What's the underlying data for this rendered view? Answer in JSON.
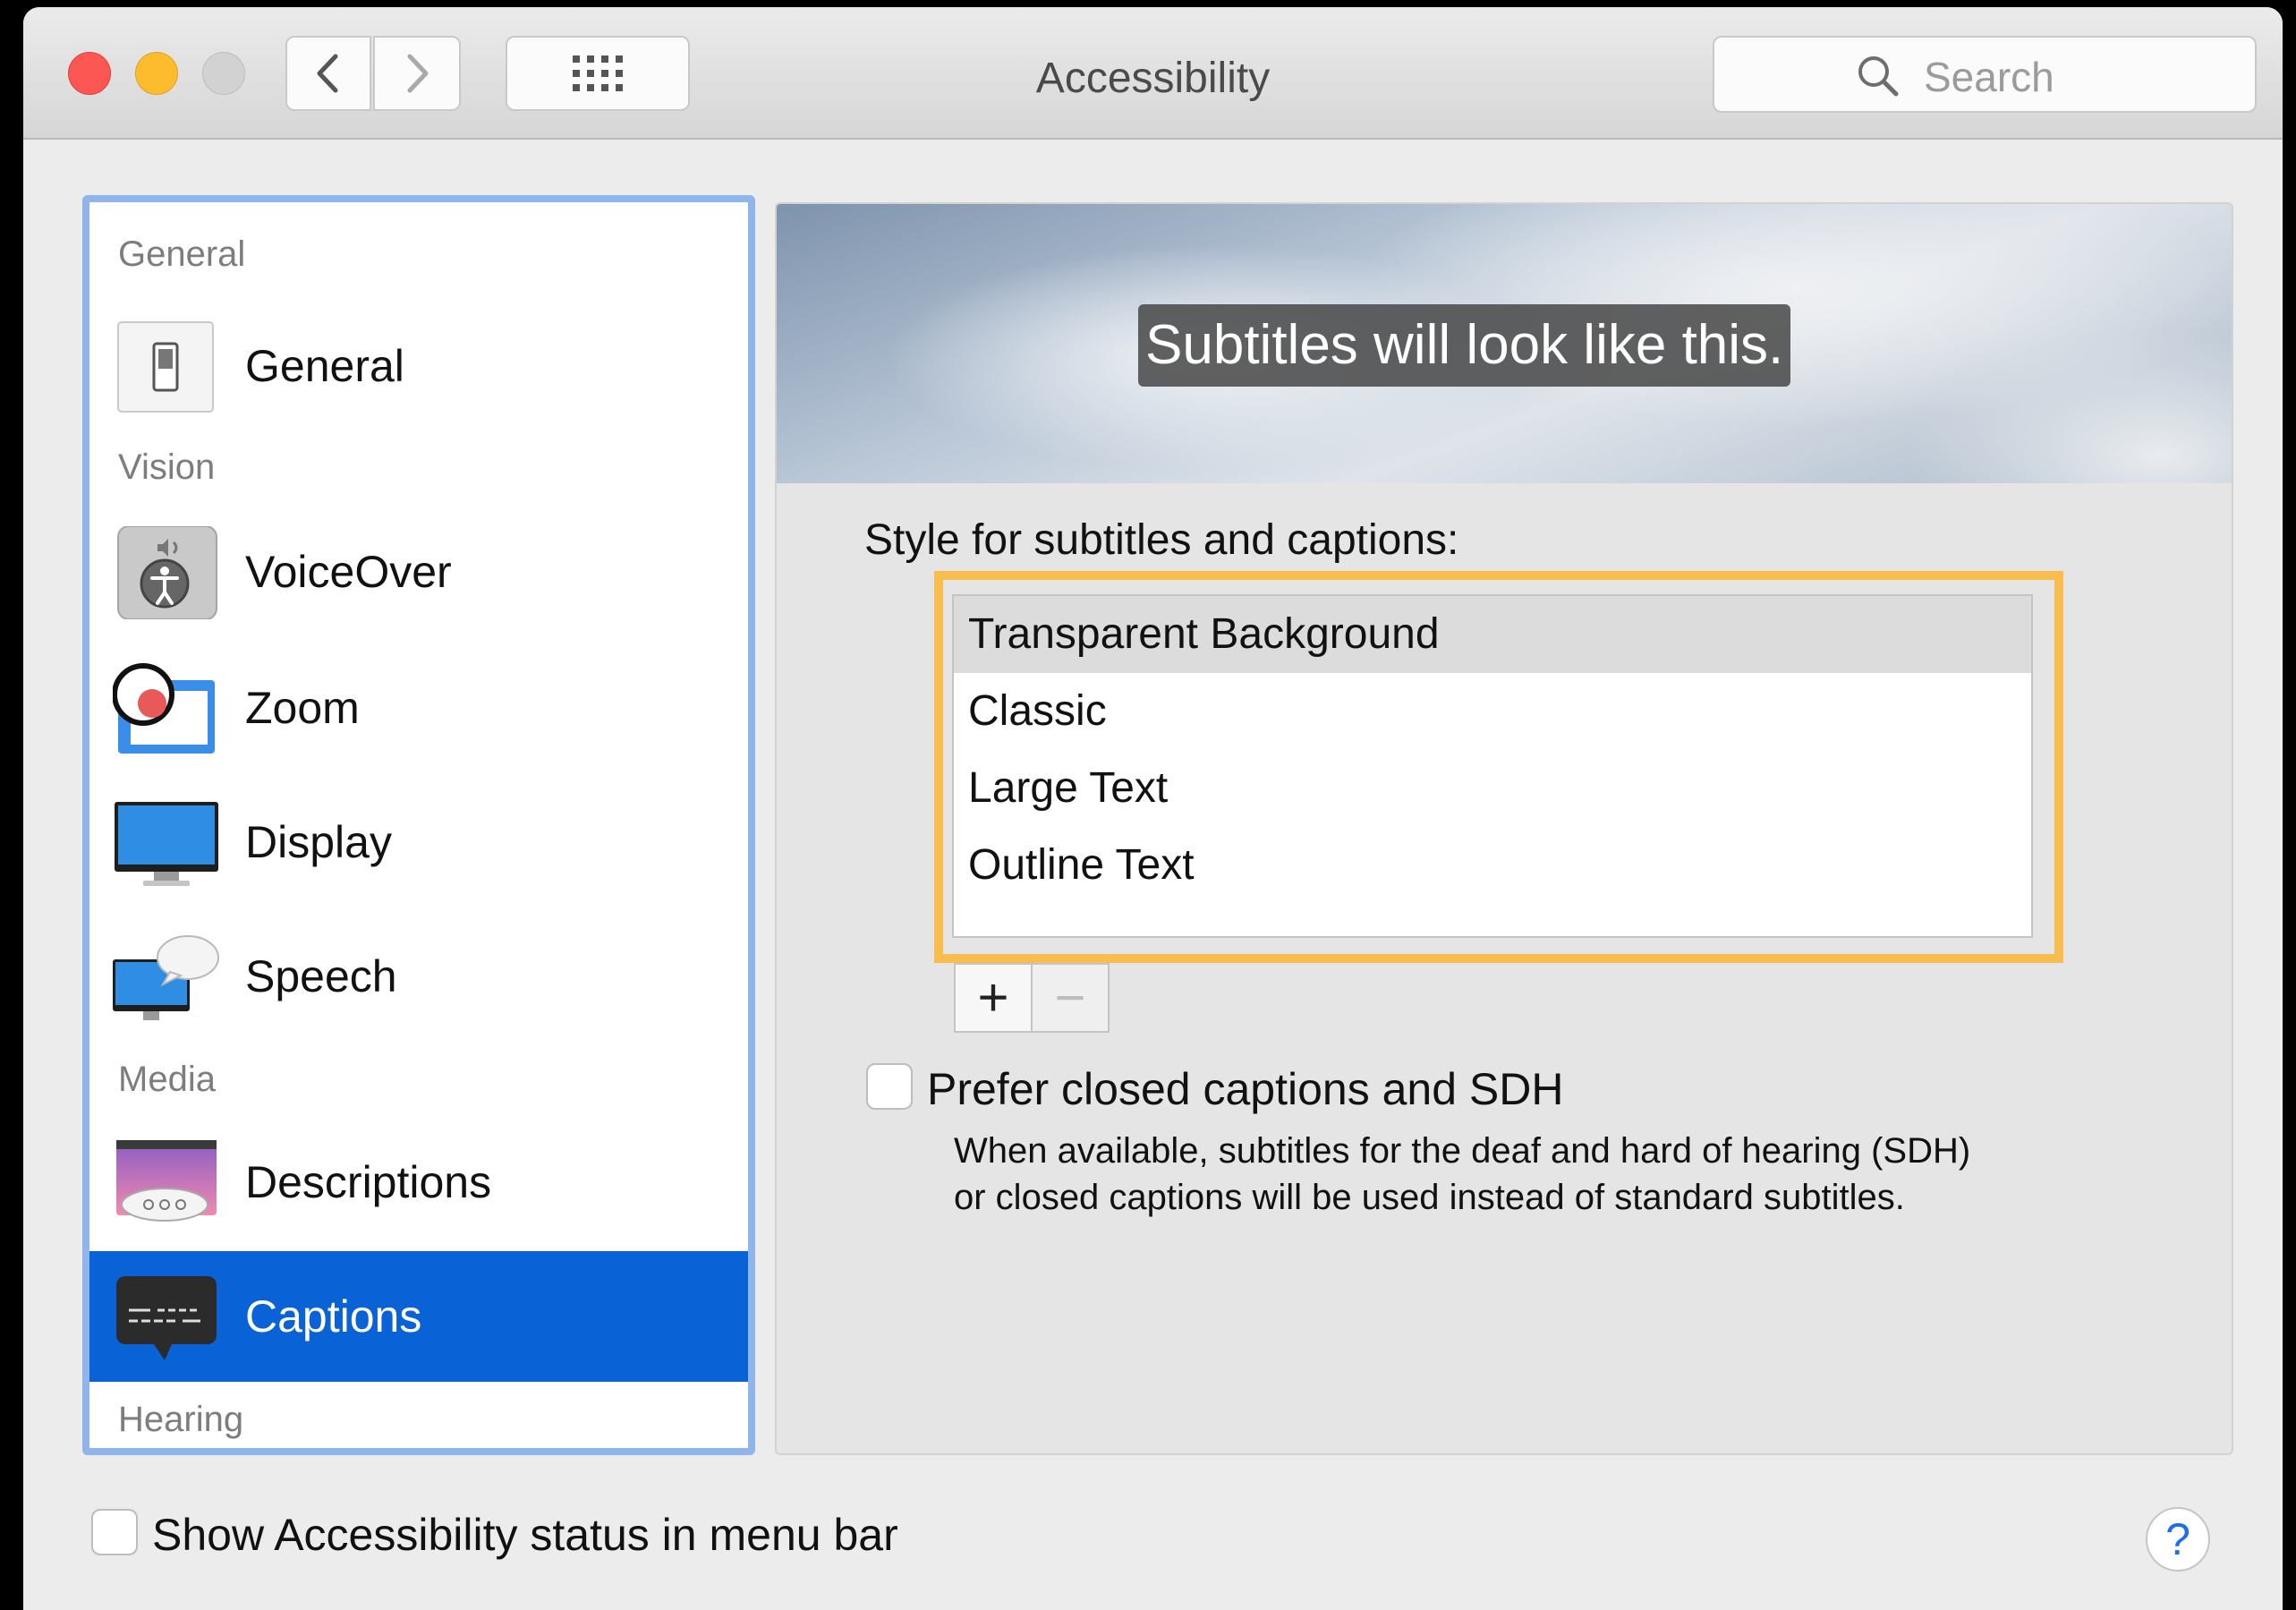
{
  "window": {
    "title": "Accessibility"
  },
  "toolbar": {
    "search_placeholder": "Search"
  },
  "sidebar": {
    "sections": [
      {
        "label": "General",
        "items": [
          {
            "label": "General",
            "icon": "switch-icon"
          }
        ]
      },
      {
        "label": "Vision",
        "items": [
          {
            "label": "VoiceOver",
            "icon": "voiceover-icon"
          },
          {
            "label": "Zoom",
            "icon": "zoom-icon"
          },
          {
            "label": "Display",
            "icon": "display-icon"
          },
          {
            "label": "Speech",
            "icon": "speech-icon"
          }
        ]
      },
      {
        "label": "Media",
        "items": [
          {
            "label": "Descriptions",
            "icon": "descriptions-icon"
          },
          {
            "label": "Captions",
            "icon": "captions-icon",
            "selected": true
          }
        ]
      },
      {
        "label": "Hearing",
        "items": []
      }
    ]
  },
  "captions": {
    "preview_text": "Subtitles will look like this.",
    "style_label": "Style for subtitles and captions:",
    "styles": [
      "Transparent Background",
      "Classic",
      "Large Text",
      "Outline Text"
    ],
    "selected_style": "Transparent Background",
    "add_label": "+",
    "remove_label": "−",
    "prefer_label": "Prefer closed captions and SDH",
    "prefer_checked": false,
    "prefer_description": "When available, subtitles for the deaf and hard of hearing (SDH) or closed captions will be used instead of standard subtitles."
  },
  "footer": {
    "status_label": "Show Accessibility status in menu bar",
    "status_checked": false,
    "help_label": "?"
  },
  "colors": {
    "selection": "#0a63d6",
    "highlight": "#f7bd4e",
    "accent": "#1c6fe6"
  }
}
